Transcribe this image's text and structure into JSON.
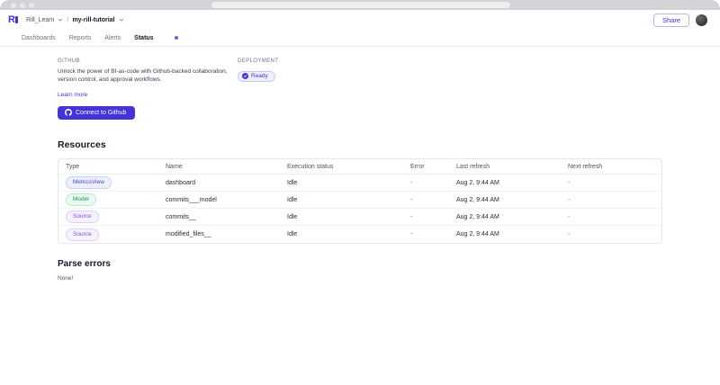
{
  "header": {
    "logo_letter": "R",
    "breadcrumb": {
      "org": "Rill_Learn",
      "slash": "/",
      "project": "my-rill-tutorial"
    },
    "share_label": "Share"
  },
  "nav": {
    "tabs": [
      "Dashboards",
      "Reports",
      "Alerts",
      "Status"
    ],
    "active_tab": "Status"
  },
  "github": {
    "label": "GITHUB",
    "description": "Unlock the power of BI-as-code with Github-backed collaboration, version control, and approval workflows.",
    "learn_more": "Learn more",
    "connect_button": "Connect to Github"
  },
  "deployment": {
    "label": "DEPLOYMENT",
    "status": "Ready"
  },
  "resources": {
    "title": "Resources",
    "columns": [
      "Type",
      "Name",
      "Execution status",
      "Error",
      "Last refresh",
      "Next refresh"
    ],
    "rows": [
      {
        "type": "MetricsView",
        "name": "dashboard",
        "status": "Idle",
        "error": "-",
        "last_refresh": "Aug 2, 9:44 AM",
        "next_refresh": "-"
      },
      {
        "type": "Model",
        "name": "commits___model",
        "status": "Idle",
        "error": "-",
        "last_refresh": "Aug 2, 9:44 AM",
        "next_refresh": "-"
      },
      {
        "type": "Source",
        "name": "commits__",
        "status": "Idle",
        "error": "-",
        "last_refresh": "Aug 2, 9:44 AM",
        "next_refresh": "-"
      },
      {
        "type": "Source",
        "name": "modified_files__",
        "status": "Idle",
        "error": "-",
        "last_refresh": "Aug 2, 9:44 AM",
        "next_refresh": "-"
      }
    ]
  },
  "parse_errors": {
    "title": "Parse errors",
    "value": "None!"
  },
  "colors": {
    "accent": "#4333d8",
    "metricsview_badge": "#4748d6",
    "model_badge": "#199462",
    "source_badge": "#8350e8",
    "chrome_bar": "#d2d2d7"
  }
}
